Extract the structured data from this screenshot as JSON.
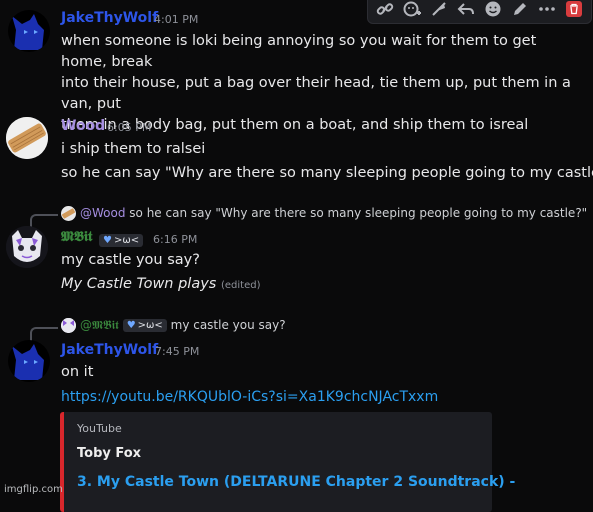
{
  "toolbar": {
    "icons": [
      "link-icon",
      "add-reaction-icon",
      "feather-icon",
      "reply-icon",
      "emoji-icon",
      "edit-icon",
      "more-icon",
      "delete-icon"
    ]
  },
  "messages": [
    {
      "author": "JakeThyWolf",
      "time": "4:01 PM",
      "lines": [
        "when someone is loki being annoying so you wait for them to get home, break",
        "into their house, put a bag over their head, tie them up, put them in a van, put",
        "them in a body bag, put them on a boat, and ship them to isreal"
      ]
    },
    {
      "author": "Wood",
      "time": "6:05 PM",
      "lines": [
        "i ship them to ralsei"
      ],
      "followup": "so he can say \"Why are there so many sleeping people going to my castle?\""
    },
    {
      "reply_to": "@Wood",
      "reply_text": "so he can say \"Why are there so many sleeping people going to my castle?\"",
      "author": "𝕸𝕭𝖎𝖙",
      "tag": ">ω<",
      "time": "6:16 PM",
      "lines": [
        "my castle you say?"
      ],
      "italic_text": "My Castle Town plays",
      "edited": "(edited)"
    },
    {
      "reply_to": "@𝕸𝕭𝖎𝖙",
      "reply_tag": ">ω<",
      "reply_text": "my castle you say?",
      "author": "JakeThyWolf",
      "time": "7:45 PM",
      "lines": [
        "on it"
      ],
      "link": "https://youtu.be/RKQUblO-iCs?si=Xa1K9chcNJAcTxxm",
      "embed": {
        "provider": "YouTube",
        "author": "Toby Fox",
        "title": "3. My Castle Town (DELTARUNE Chapter 2 Soundtrack) -"
      }
    }
  ],
  "colors": {
    "jake": "#2d55e8",
    "wood": "#a58ee0",
    "mbit": "#3b8a3e",
    "link": "#2b9ff0",
    "embed_border": "#d8272c"
  },
  "watermark": "imgflip.com"
}
